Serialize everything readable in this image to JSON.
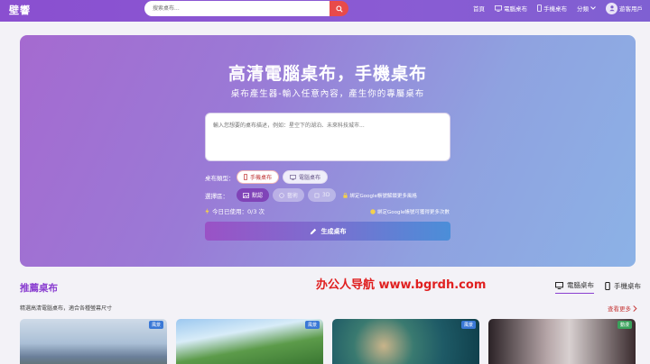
{
  "header": {
    "logo": "壁響",
    "search_placeholder": "搜索桌布...",
    "nav": {
      "home": "首頁",
      "desktop": "電腦桌布",
      "mobile": "手機桌布",
      "category": "分類",
      "user": "遊客用戶"
    }
  },
  "hero": {
    "title": "高清電腦桌布，手機桌布",
    "subtitle": "桌布產生器-輸入任意內容，產生你的專屬桌布",
    "prompt_placeholder": "輸入您想要的桌布描述，例如：星空下的湖泊、未來科技城市...",
    "type_label": "桌布類型：",
    "type_options": [
      "手機桌布",
      "電腦桌布"
    ],
    "style_label": "選擇區：",
    "style_options": [
      "默認",
      "藝術",
      "3D"
    ],
    "login_note": "綁定Google帳號解鎖更多風格",
    "usage": "今日已使用：0/3 次",
    "usage_note": "綁定Google帳號可獲得更多次數",
    "generate": "生成桌布"
  },
  "recommend": {
    "title": "推薦桌布",
    "watermark": "办公人导航 www.bgrdh.com",
    "tabs": [
      "電腦桌布",
      "手機桌布"
    ],
    "desc": "精選高清電腦桌布，適合各種螢幕尺寸",
    "see_more": "查看更多",
    "thumbs": [
      {
        "badge": "風景"
      },
      {
        "badge": "風景"
      },
      {
        "badge": "風景"
      },
      {
        "badge": "動漫"
      }
    ]
  },
  "colors": {
    "accent": "#8a3fd0",
    "danger": "#e84a4a"
  }
}
